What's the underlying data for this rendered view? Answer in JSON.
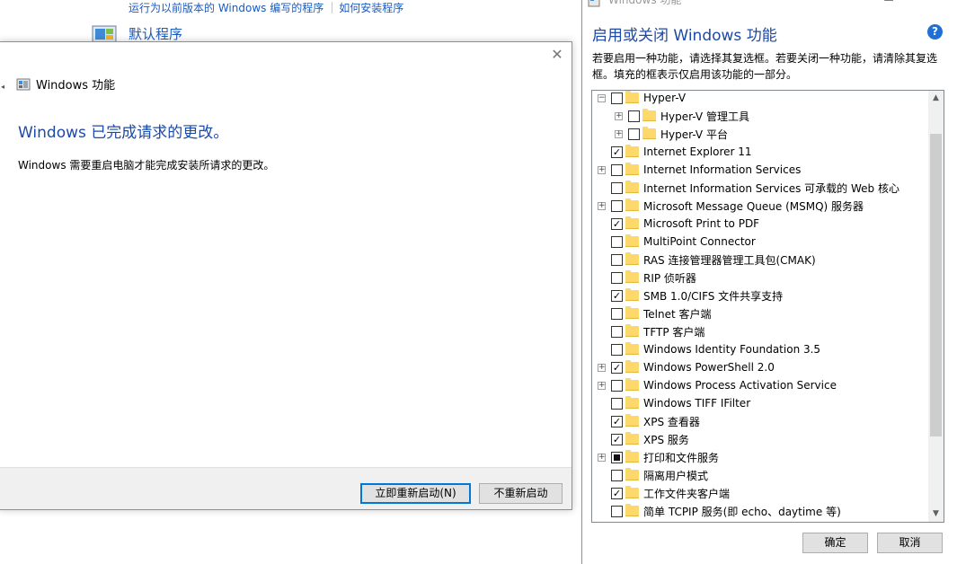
{
  "background_panel": {
    "links": [
      "运行为以前版本的 Windows 编写的程序",
      "如何安装程序"
    ],
    "default_programs": "默认程序"
  },
  "done_dialog": {
    "window_title": "Windows 功能",
    "heading": "Windows 已完成请求的更改。",
    "message": "Windows 需要重启电脑才能完成安装所请求的更改。",
    "restart_button": "立即重新启动(N)",
    "no_restart_button": "不重新启动"
  },
  "features_window": {
    "title": "Windows 功能",
    "heading": "启用或关闭 Windows 功能",
    "description": "若要启用一种功能，请选择其复选框。若要关闭一种功能，请清除其复选框。填充的框表示仅启用该功能的一部分。",
    "help_glyph": "?",
    "ok_button": "确定",
    "cancel_button": "取消",
    "features": [
      {
        "label": "Hyper-V",
        "state": "unchecked",
        "expander": "minus",
        "level": 0
      },
      {
        "label": "Hyper-V 管理工具",
        "state": "unchecked",
        "expander": "plus",
        "level": 1
      },
      {
        "label": "Hyper-V 平台",
        "state": "unchecked",
        "expander": "plus",
        "level": 1
      },
      {
        "label": "Internet Explorer 11",
        "state": "checked",
        "expander": "none",
        "level": 0
      },
      {
        "label": "Internet Information Services",
        "state": "unchecked",
        "expander": "plus",
        "level": 0
      },
      {
        "label": "Internet Information Services 可承载的 Web 核心",
        "state": "unchecked",
        "expander": "none",
        "level": 0
      },
      {
        "label": "Microsoft Message Queue (MSMQ) 服务器",
        "state": "unchecked",
        "expander": "plus",
        "level": 0
      },
      {
        "label": "Microsoft Print to PDF",
        "state": "checked",
        "expander": "none",
        "level": 0
      },
      {
        "label": "MultiPoint Connector",
        "state": "unchecked",
        "expander": "none",
        "level": 0
      },
      {
        "label": "RAS 连接管理器管理工具包(CMAK)",
        "state": "unchecked",
        "expander": "none",
        "level": 0
      },
      {
        "label": "RIP 侦听器",
        "state": "unchecked",
        "expander": "none",
        "level": 0
      },
      {
        "label": "SMB 1.0/CIFS 文件共享支持",
        "state": "checked",
        "expander": "none",
        "level": 0
      },
      {
        "label": "Telnet 客户端",
        "state": "unchecked",
        "expander": "none",
        "level": 0
      },
      {
        "label": "TFTP 客户端",
        "state": "unchecked",
        "expander": "none",
        "level": 0
      },
      {
        "label": "Windows Identity Foundation 3.5",
        "state": "unchecked",
        "expander": "none",
        "level": 0
      },
      {
        "label": "Windows PowerShell 2.0",
        "state": "checked",
        "expander": "plus",
        "level": 0
      },
      {
        "label": "Windows Process Activation Service",
        "state": "unchecked",
        "expander": "plus",
        "level": 0
      },
      {
        "label": "Windows TIFF IFilter",
        "state": "unchecked",
        "expander": "none",
        "level": 0
      },
      {
        "label": "XPS 查看器",
        "state": "checked",
        "expander": "none",
        "level": 0
      },
      {
        "label": "XPS 服务",
        "state": "checked",
        "expander": "none",
        "level": 0
      },
      {
        "label": "打印和文件服务",
        "state": "partial",
        "expander": "plus",
        "level": 0
      },
      {
        "label": "隔离用户模式",
        "state": "unchecked",
        "expander": "none",
        "level": 0
      },
      {
        "label": "工作文件夹客户端",
        "state": "checked",
        "expander": "none",
        "level": 0
      },
      {
        "label": "简单 TCPIP 服务(即 echo、daytime 等)",
        "state": "unchecked",
        "expander": "none",
        "level": 0
      }
    ]
  }
}
